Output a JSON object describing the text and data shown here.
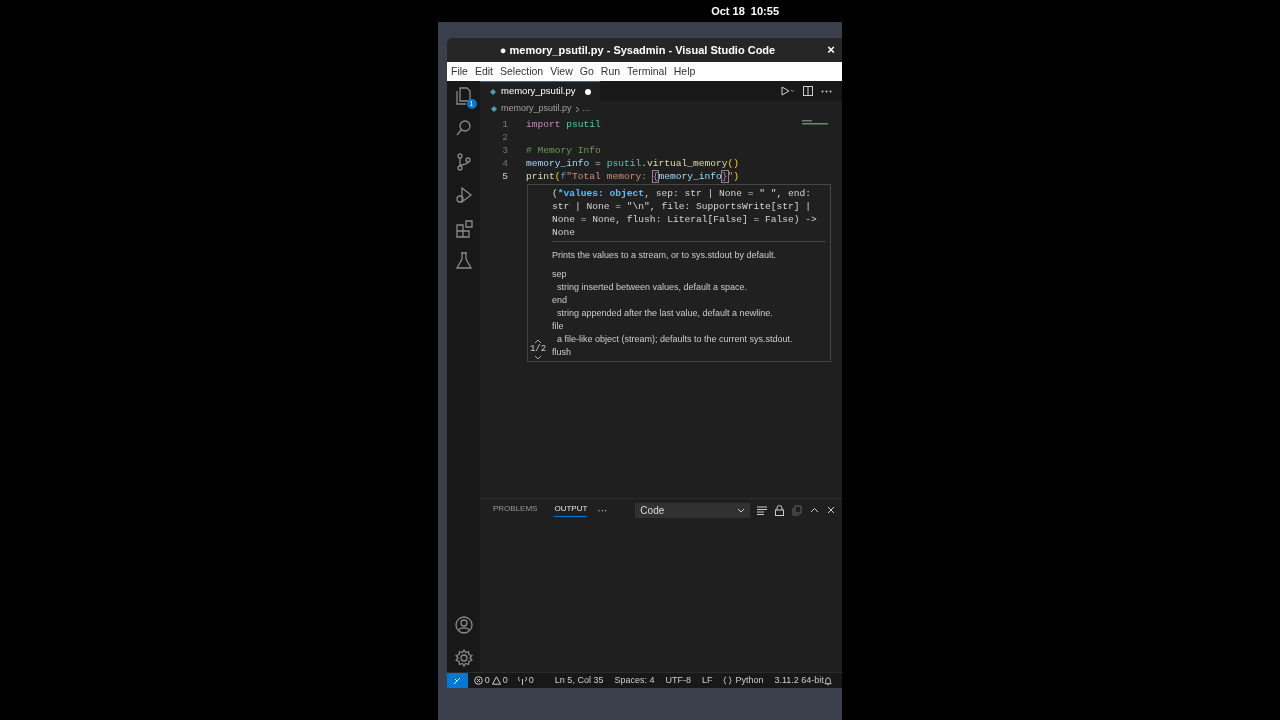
{
  "top_bar": {
    "clock": "Oct 18  10:55"
  },
  "window": {
    "title": "● memory_psutil.py - Sysadmin - Visual Studio Code",
    "close": "×"
  },
  "menu": [
    "File",
    "Edit",
    "Selection",
    "View",
    "Go",
    "Run",
    "Terminal",
    "Help"
  ],
  "activity_bar": {
    "explorer_badge": "1"
  },
  "editor_tabs": [
    {
      "label": "memory_psutil.py",
      "modified": true,
      "selected": true
    }
  ],
  "breadcrumb": [
    "memory_psutil.py",
    "..."
  ],
  "code": [
    {
      "number": "1",
      "current": false,
      "tokens": [
        {
          "text": "import",
          "kind": "keyword"
        },
        {
          "text": " psutil",
          "kind": "module"
        }
      ]
    },
    {
      "number": "2",
      "current": false
    },
    {
      "number": "3",
      "current": false,
      "tokens": [
        {
          "text": "# Memory Info",
          "kind": "comment"
        }
      ]
    },
    {
      "number": "4",
      "current": false,
      "tokens": [
        {
          "text": "memory_info",
          "kind": "variable"
        },
        {
          "text": " = ",
          "kind": "plain"
        },
        {
          "text": "psutil",
          "kind": "module"
        },
        {
          "text": ".",
          "kind": "plain"
        },
        {
          "text": "virtual_memory",
          "kind": "function"
        },
        {
          "text": "()",
          "kind": "bracket"
        }
      ]
    },
    {
      "number": "5",
      "current": true,
      "tokens": [
        {
          "text": "print",
          "kind": "function"
        },
        {
          "text": "(",
          "kind": "bracket"
        },
        {
          "text": "f",
          "kind": "keyword_blue"
        },
        {
          "text": "\"Total memory: ",
          "kind": "string"
        },
        {
          "text": "{",
          "kind": "match"
        },
        {
          "text": "memory_info",
          "kind": "variable"
        },
        {
          "text": "}",
          "kind": "match"
        },
        {
          "text": "\"",
          "kind": "string"
        },
        {
          "text": ")",
          "kind": "bracket"
        }
      ]
    }
  ],
  "hover": {
    "signature": [
      [
        {
          "text": "(",
          "kind": "plain"
        },
        {
          "text": "*values: object",
          "kind": "active"
        },
        {
          "text": ", sep: str | None = \" \", end:",
          "kind": "plain"
        }
      ],
      [
        {
          "text": "str | None = \"\\n\", file: SupportsWrite[str] |",
          "kind": "plain"
        }
      ],
      [
        {
          "text": "None = None, flush: Literal[False] = False) ->",
          "kind": "plain"
        }
      ],
      [
        {
          "text": "None",
          "kind": "plain"
        }
      ]
    ],
    "description": "Prints the values to a stream, or to sys.stdout by default.",
    "params": [
      {
        "name": "sep",
        "text": "string inserted between values, default a space."
      },
      {
        "name": "end",
        "text": "string appended after the last value, default a newline."
      },
      {
        "name": "file",
        "text": "a file-like object (stream); defaults to the current sys.stdout."
      },
      {
        "name": "flush"
      }
    ],
    "pager": "1/2"
  },
  "panel": {
    "tabs": [
      {
        "label": "PROBLEMS",
        "selected": false
      },
      {
        "label": "OUTPUT",
        "selected": true
      }
    ],
    "more": "···",
    "dropdown": "Code"
  },
  "status_bar": {
    "errors": "0",
    "warnings": "0",
    "ports": "0",
    "items": [
      "Ln 5, Col 35",
      "Spaces: 4",
      "UTF-8",
      "LF"
    ],
    "language": "Python",
    "interpreter": "3.11.2 64-bit"
  }
}
